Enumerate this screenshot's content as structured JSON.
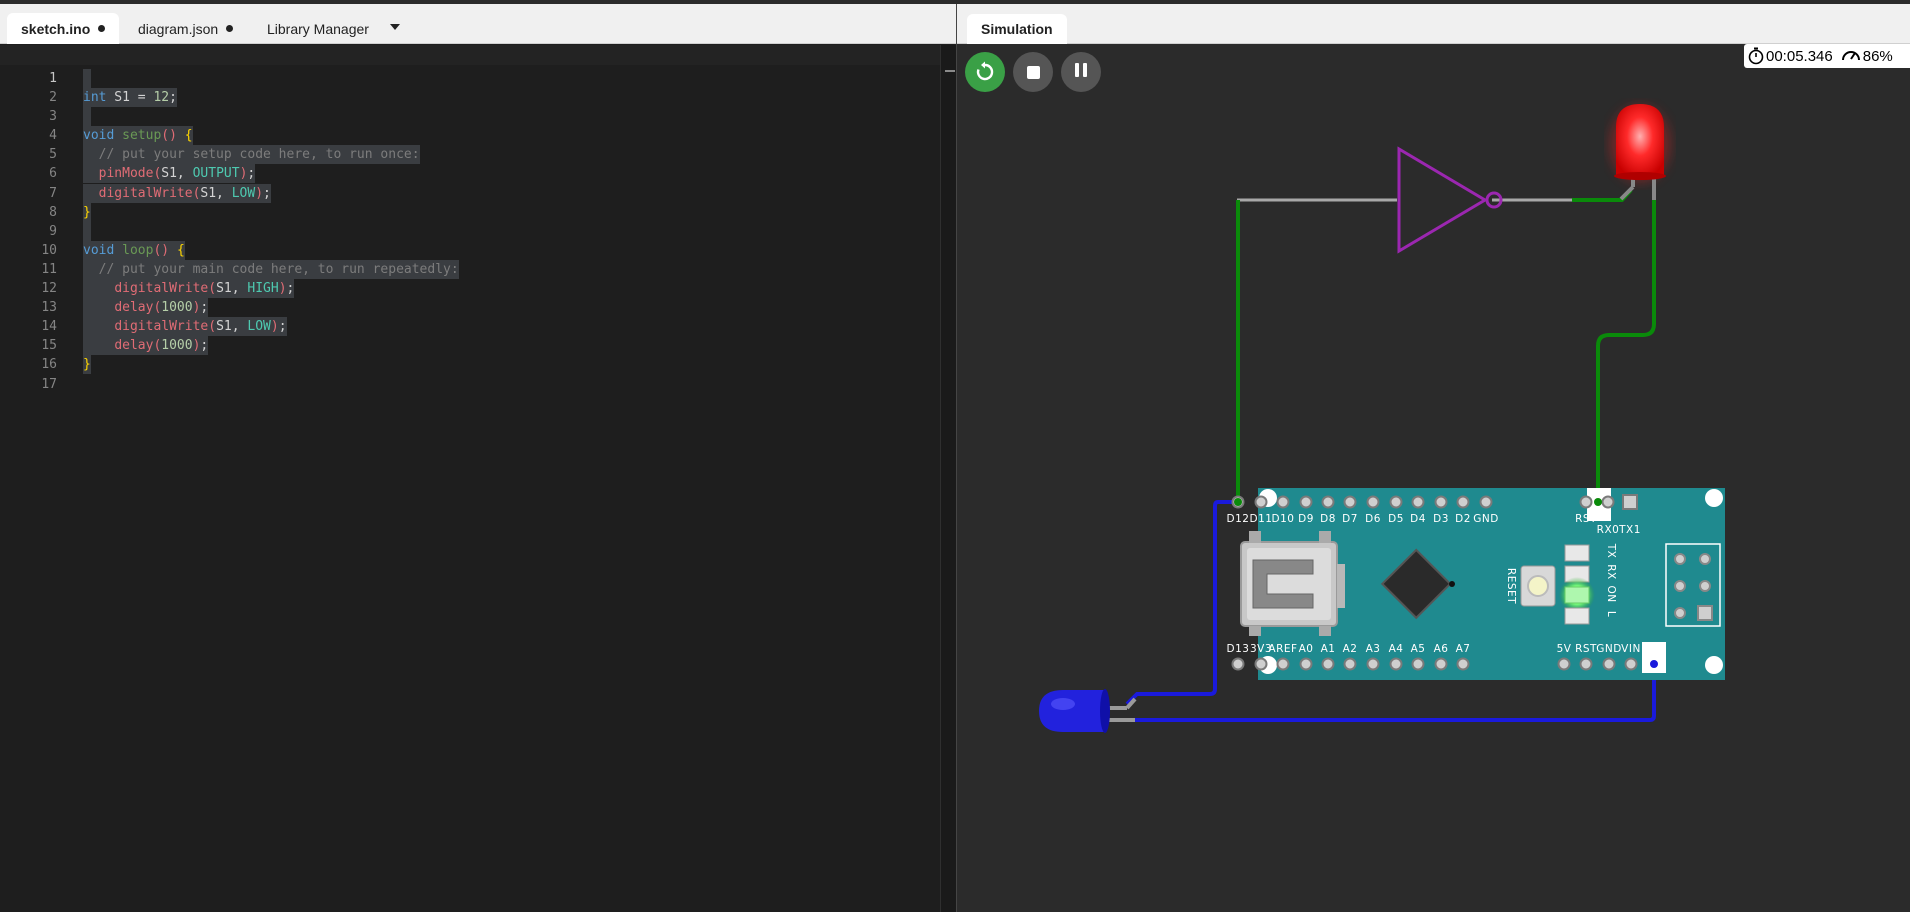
{
  "editor": {
    "tabs": [
      {
        "label": "sketch.ino",
        "modified": true
      },
      {
        "label": "diagram.json",
        "modified": true
      },
      {
        "label": "Library Manager"
      }
    ],
    "lines": [
      {
        "n": "1",
        "text": ""
      },
      {
        "n": "2",
        "text": "int S1 = 12;"
      },
      {
        "n": "3",
        "text": ""
      },
      {
        "n": "4",
        "text": "void setup() {"
      },
      {
        "n": "5",
        "text": "  // put your setup code here, to run once:"
      },
      {
        "n": "6",
        "text": "  pinMode(S1, OUTPUT);"
      },
      {
        "n": "7",
        "text": "  digitalWrite(S1, LOW);"
      },
      {
        "n": "8",
        "text": "}"
      },
      {
        "n": "9",
        "text": ""
      },
      {
        "n": "10",
        "text": "void loop() {"
      },
      {
        "n": "11",
        "text": "  // put your main code here, to run repeatedly:"
      },
      {
        "n": "12",
        "text": "    digitalWrite(S1, HIGH);"
      },
      {
        "n": "13",
        "text": "    delay(1000);"
      },
      {
        "n": "14",
        "text": "    digitalWrite(S1, LOW);"
      },
      {
        "n": "15",
        "text": "    delay(1000);"
      },
      {
        "n": "16",
        "text": "}"
      },
      {
        "n": "17",
        "text": ""
      }
    ]
  },
  "simulation": {
    "tab_label": "Simulation",
    "timer": "00:05.346",
    "speed": "86%",
    "timer_icon": "stopwatch-icon",
    "speed_icon": "speedometer-icon",
    "board": {
      "top_pins": [
        "D12",
        "D11",
        "D10",
        "D9",
        "D8",
        "D7",
        "D6",
        "D5",
        "D4",
        "D3",
        "D2",
        "GND",
        "RST",
        "RX0",
        "TX1"
      ],
      "bottom_pins": [
        "D13",
        "3V3",
        "AREF",
        "A0",
        "A1",
        "A2",
        "A3",
        "A4",
        "A5",
        "A6",
        "A7",
        "5V",
        "RST",
        "GND",
        "VIN"
      ],
      "reset_label": "RESET",
      "led_labels": [
        "TX",
        "RX",
        "ON",
        "L"
      ]
    },
    "colors": {
      "wire_green": "#0a8a0a",
      "wire_blue": "#1a1adc",
      "board": "#1f8a8f",
      "inverter": "#9b27b0",
      "led_red": "#ff3030",
      "led_blue": "#2222dd"
    }
  }
}
